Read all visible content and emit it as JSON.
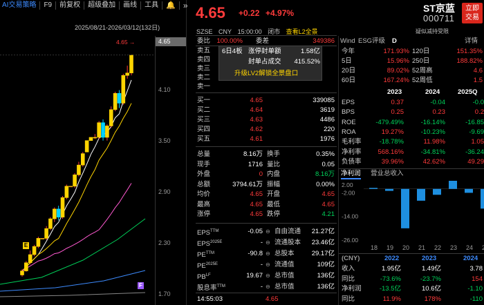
{
  "toolbar": {
    "ai_label": "AI交易策略",
    "f9_label": "F9",
    "adjust_label": "前复权",
    "overlay_label": "超级叠加",
    "draw_label": "画线",
    "tools_label": "工具"
  },
  "chart": {
    "date_range": "2025/08/21-2026/03/12(132日)",
    "current_price_tag": "4.65",
    "current_price_marker": "4.65",
    "axis_ticks": [
      "4.10",
      "3.50",
      "2.90",
      "2.30",
      "1.70"
    ],
    "badge_e": "E",
    "badge_f": "F",
    "colors": {
      "up": "#ff3b3b",
      "down": "#00d2ff",
      "ma5": "#ffffff",
      "ma10": "#ffd400",
      "ma20": "#ff5ad1",
      "ma60": "#00d25a",
      "ma120": "#3d8bff"
    }
  },
  "chart_data": {
    "type": "candlestick",
    "series_note": "daily K-line, last ~40 visible bars",
    "ylim": [
      1.7,
      4.75
    ],
    "candles": [
      {
        "o": 1.95,
        "h": 2.02,
        "l": 1.93,
        "c": 2.0
      },
      {
        "o": 2.0,
        "h": 2.12,
        "l": 1.99,
        "c": 2.1
      },
      {
        "o": 2.1,
        "h": 2.25,
        "l": 2.08,
        "c": 2.2
      },
      {
        "o": 2.2,
        "h": 2.32,
        "l": 2.18,
        "c": 2.3
      },
      {
        "o": 2.3,
        "h": 2.42,
        "l": 2.28,
        "c": 2.4
      },
      {
        "o": 2.4,
        "h": 2.4,
        "l": 2.4,
        "c": 2.4
      },
      {
        "o": 2.4,
        "h": 2.55,
        "l": 2.38,
        "c": 2.52
      },
      {
        "o": 2.52,
        "h": 2.66,
        "l": 2.5,
        "c": 2.64
      },
      {
        "o": 2.64,
        "h": 2.78,
        "l": 2.6,
        "c": 2.76
      },
      {
        "o": 2.76,
        "h": 2.8,
        "l": 2.62,
        "c": 2.66
      },
      {
        "o": 2.66,
        "h": 2.92,
        "l": 2.64,
        "c": 2.9
      },
      {
        "o": 2.9,
        "h": 3.06,
        "l": 2.88,
        "c": 3.04
      },
      {
        "o": 3.04,
        "h": 3.04,
        "l": 3.04,
        "c": 3.04
      },
      {
        "o": 3.04,
        "h": 3.2,
        "l": 3.02,
        "c": 3.18
      },
      {
        "o": 3.18,
        "h": 3.34,
        "l": 3.16,
        "c": 3.3
      },
      {
        "o": 3.3,
        "h": 3.46,
        "l": 3.28,
        "c": 3.44
      },
      {
        "o": 3.46,
        "h": 3.6,
        "l": 3.46,
        "c": 3.6
      },
      {
        "o": 3.6,
        "h": 3.64,
        "l": 3.6,
        "c": 3.64
      },
      {
        "o": 3.64,
        "h": 3.68,
        "l": 3.62,
        "c": 3.64
      },
      {
        "o": 3.64,
        "h": 3.84,
        "l": 3.62,
        "c": 3.82
      },
      {
        "o": 3.82,
        "h": 3.86,
        "l": 3.6,
        "c": 3.64
      },
      {
        "o": 3.64,
        "h": 3.8,
        "l": 3.6,
        "c": 3.78
      },
      {
        "o": 3.78,
        "h": 4.02,
        "l": 3.76,
        "c": 3.98
      },
      {
        "o": 3.98,
        "h": 4.2,
        "l": 3.96,
        "c": 4.18
      },
      {
        "o": 4.18,
        "h": 4.22,
        "l": 4.0,
        "c": 4.06
      },
      {
        "o": 4.06,
        "h": 4.42,
        "l": 4.04,
        "c": 4.4
      },
      {
        "o": 4.4,
        "h": 4.52,
        "l": 4.36,
        "c": 4.43
      },
      {
        "o": 4.43,
        "h": 4.65,
        "l": 4.4,
        "c": 4.65
      }
    ]
  },
  "header": {
    "price": "4.65",
    "change": "+0.22",
    "change_pct": "+4.97%",
    "name": "ST京蓝",
    "code": "000711",
    "trade_btn_line1": "立即",
    "trade_btn_line2": "交易",
    "exchange": "SZSE",
    "currency": "CNY",
    "time": "15:00:00",
    "status": "闭市",
    "l2_link": "查看L2全景",
    "right_note": "疑似减持受限"
  },
  "orderbook": {
    "weibi_label": "委比",
    "weibi_value": "100.00%",
    "weicha_label": "委差",
    "weicha_value": "349386",
    "asks": [
      {
        "label": "卖五",
        "price": "",
        "vol": ""
      },
      {
        "label": "卖四",
        "price": "",
        "vol": ""
      },
      {
        "label": "卖三",
        "price": "",
        "vol": ""
      },
      {
        "label": "卖二",
        "price": "",
        "vol": ""
      },
      {
        "label": "卖一",
        "price": "",
        "vol": ""
      }
    ],
    "bids": [
      {
        "label": "买一",
        "price": "4.65",
        "vol": "339085"
      },
      {
        "label": "买二",
        "price": "4.64",
        "vol": "3619"
      },
      {
        "label": "买三",
        "price": "4.63",
        "vol": "4486"
      },
      {
        "label": "买四",
        "price": "4.62",
        "vol": "220"
      },
      {
        "label": "买五",
        "price": "4.61",
        "vol": "1976"
      }
    ],
    "popup": {
      "title": "6日4板",
      "seal_label": "涨停封单额",
      "seal_value": "1.58亿",
      "ratio_label": "封单占成交",
      "ratio_value": "415.52%",
      "upgrade_btn": "升级LV2解锁全景盘口"
    }
  },
  "stats": [
    {
      "l1": "总量",
      "v1": "8.16万",
      "l2": "换手",
      "v2": "0.35%",
      "c1": "white",
      "c2": "white"
    },
    {
      "l1": "现手",
      "v1": "1716",
      "l2": "量比",
      "v2": "0.05",
      "c1": "white",
      "c2": "white"
    },
    {
      "l1": "外盘",
      "v1": "0",
      "l2": "内盘",
      "v2": "8.16万",
      "c1": "red",
      "c2": "green"
    },
    {
      "l1": "总额",
      "v1": "3794.61万",
      "l2": "振幅",
      "v2": "0.00%",
      "c1": "white",
      "c2": "white"
    },
    {
      "l1": "均价",
      "v1": "4.65",
      "l2": "开盘",
      "v2": "4.65",
      "c1": "red",
      "c2": "red"
    },
    {
      "l1": "最高",
      "v1": "4.65",
      "l2": "最低",
      "v2": "4.65",
      "c1": "red",
      "c2": "red"
    },
    {
      "l1": "涨停",
      "v1": "4.65",
      "l2": "跌停",
      "v2": "4.21",
      "c1": "red",
      "c2": "green"
    }
  ],
  "fundamentals": [
    {
      "l1": "EPS",
      "sup1": "TTM",
      "v1": "-0.05",
      "l2": "自由流通",
      "v2": "21.27亿"
    },
    {
      "l1": "EPS",
      "sup1": "2025E",
      "v1": "-",
      "l2": "流通股本",
      "v2": "23.46亿"
    },
    {
      "l1": "PE",
      "sup1": "TTM",
      "v1": "-90.8",
      "l2": "总股本",
      "v2": "29.17亿"
    },
    {
      "l1": "PE",
      "sup1": "2025E",
      "v1": "-",
      "l2": "流通值",
      "v2": "109亿"
    },
    {
      "l1": "PB",
      "sup1": "LF",
      "v1": "19.67",
      "l2": "总市值",
      "v2": "136亿"
    },
    {
      "l1": "股息率",
      "sup1": "TTM",
      "v1": "-",
      "l2": "总市值",
      "v2": "136亿"
    }
  ],
  "last_trade": {
    "time": "14:55:03",
    "price": "4.65"
  },
  "right": {
    "tab_wind": "Wind",
    "tab_esg": "ESG评级",
    "esg_grade": "D",
    "detail_link": "详情",
    "perf": [
      {
        "l1": "今年",
        "v1": "171.93%",
        "l2": "120日",
        "v2": "151.35%"
      },
      {
        "l1": "5日",
        "v1": "15.96%",
        "l2": "250日",
        "v2": "188.82%"
      },
      {
        "l1": "20日",
        "v1": "89.02%",
        "l2": "52周高",
        "v2": "4.6"
      },
      {
        "l1": "60日",
        "v1": "167.24%",
        "l2": "52周低",
        "v2": "1.5"
      }
    ],
    "fin_years": [
      "2023",
      "2024",
      "2025Q"
    ],
    "fin_rows": [
      {
        "label": "EPS",
        "vals": [
          "0.37",
          "-0.04",
          "-0.0"
        ]
      },
      {
        "label": "BPS",
        "vals": [
          "0.25",
          "0.23",
          "0.2"
        ]
      },
      {
        "label": "ROE",
        "vals": [
          "-479.49%",
          "-16.14%",
          "-16.85"
        ]
      },
      {
        "label": "ROA",
        "vals": [
          "19.27%",
          "-10.23%",
          "-9.69"
        ]
      },
      {
        "label": "毛利率",
        "vals": [
          "-18.78%",
          "11.98%",
          "1.05"
        ]
      },
      {
        "label": "净利率",
        "vals": [
          "568.16%",
          "-34.81%",
          "-36.24"
        ]
      },
      {
        "label": "负债率",
        "vals": [
          "39.96%",
          "42.62%",
          "49.29"
        ]
      }
    ],
    "tab_profit": "净利润",
    "tab_revenue": "营业总收入",
    "bar_axis": [
      "2.00",
      "-2.00",
      "-14.00",
      "-26.00"
    ],
    "bar_x_labels": [
      "18",
      "19",
      "20",
      "21",
      "22",
      "23",
      "24",
      "25"
    ],
    "bar_values": [
      0.5,
      -1.0,
      -20.0,
      -6.0,
      -3.0,
      5.0,
      -2.0,
      -10.0
    ],
    "table_hdr": [
      "(CNY)",
      "2022",
      "2023",
      "2024"
    ],
    "table_rows": [
      {
        "label": "收入",
        "vals": [
          "1.95亿",
          "1.49亿",
          "3.78"
        ]
      },
      {
        "label": "同比",
        "vals": [
          "-73.6%",
          "-23.7%",
          "154"
        ]
      },
      {
        "label": "净利润",
        "vals": [
          "-13.5亿",
          "10.6亿",
          "-1.10"
        ]
      },
      {
        "label": "同比",
        "vals": [
          "11.9%",
          "178%",
          "-110"
        ]
      }
    ]
  }
}
